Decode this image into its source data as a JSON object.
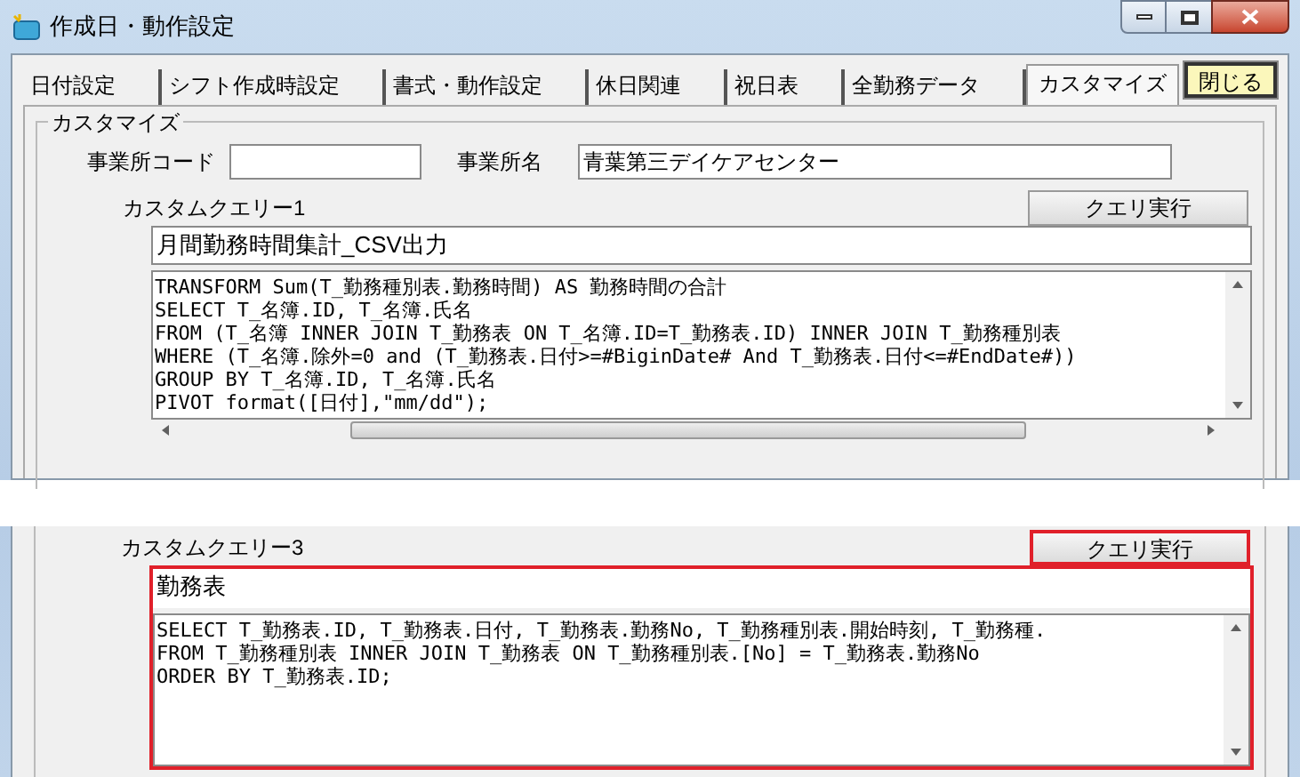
{
  "window": {
    "title": "作成日・動作設定"
  },
  "close_button": {
    "label": "閉じる"
  },
  "tabs": [
    {
      "label": "日付設定",
      "selected": false
    },
    {
      "label": "シフト作成時設定",
      "selected": false
    },
    {
      "label": "書式・動作設定",
      "selected": false
    },
    {
      "label": "休日関連",
      "selected": false
    },
    {
      "label": "祝日表",
      "selected": false
    },
    {
      "label": "全勤務データ",
      "selected": false
    },
    {
      "label": "カスタマイズ",
      "selected": true
    }
  ],
  "group": {
    "title": "カスタマイズ"
  },
  "office_code": {
    "label": "事業所コード"
  },
  "office_name": {
    "label": "事業所名",
    "value": "青葉第三デイケアセンター"
  },
  "queries": [
    {
      "label": "カスタムクエリー1",
      "button": "クエリ実行",
      "name": "月間勤務時間集計_CSV出力",
      "highlighted": false,
      "sql": [
        "TRANSFORM Sum(T_勤務種別表.勤務時間) AS 勤務時間の合計",
        "SELECT T_名簿.ID, T_名簿.氏名",
        "FROM (T_名簿 INNER JOIN T_勤務表 ON T_名簿.ID=T_勤務表.ID) INNER JOIN T_勤務種別表",
        "WHERE (T_名簿.除外=0 and (T_勤務表.日付>=#BiginDate# And T_勤務表.日付<=#EndDate#))",
        "GROUP BY T_名簿.ID, T_名簿.氏名",
        "PIVOT format([日付],\"mm/dd\");"
      ]
    },
    {
      "label": "カスタムクエリー3",
      "button": "クエリ実行",
      "name": "勤務表",
      "highlighted": true,
      "sql": [
        "SELECT T_勤務表.ID, T_勤務表.日付, T_勤務表.勤務No, T_勤務種別表.開始時刻, T_勤務種.",
        "FROM T_勤務種別表 INNER JOIN T_勤務表 ON T_勤務種別表.[No] = T_勤務表.勤務No",
        "ORDER BY T_勤務表.ID;"
      ]
    }
  ]
}
